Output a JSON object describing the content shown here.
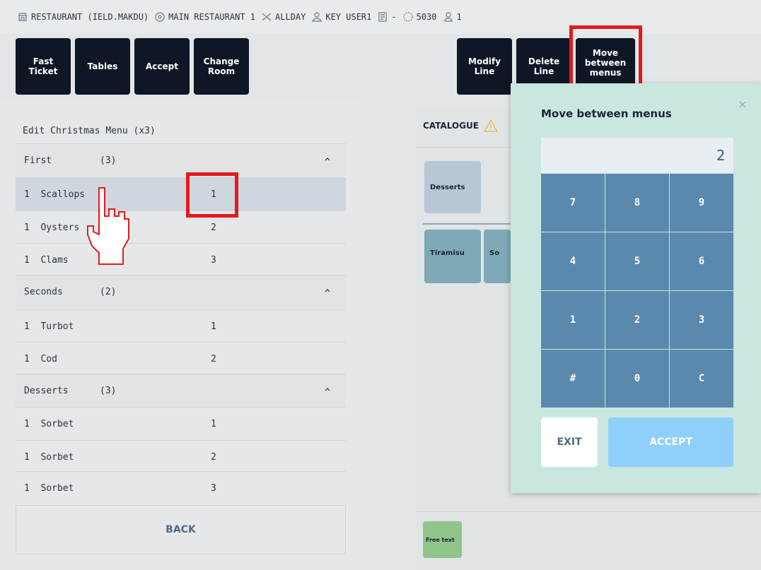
{
  "topbar": {
    "restaurant": "RESTAURANT (IELD.MAKDU)",
    "location": "MAIN RESTAURANT 1",
    "menu": "ALLDAY",
    "user": "KEY USER1",
    "doc": "-",
    "code": "5030",
    "guests": "1"
  },
  "toolbar": {
    "fast_ticket": "Fast Ticket",
    "tables": "Tables",
    "accept": "Accept",
    "change_room": "Change Room",
    "modify_line": "Modify Line",
    "delete_line": "Delete Line",
    "move_between_menus": "Move between menus"
  },
  "left": {
    "title": "Edit Christmas Menu (x3)",
    "sections": [
      {
        "name": "First",
        "count": "(3)",
        "items": [
          {
            "qty": "1",
            "name": "Scallops",
            "num": "1"
          },
          {
            "qty": "1",
            "name": "Oysters",
            "num": "2"
          },
          {
            "qty": "1",
            "name": "Clams",
            "num": "3"
          }
        ]
      },
      {
        "name": "Seconds",
        "count": "(2)",
        "items": [
          {
            "qty": "1",
            "name": "Turbot",
            "num": "1"
          },
          {
            "qty": "1",
            "name": "Cod",
            "num": "2"
          }
        ]
      },
      {
        "name": "Desserts",
        "count": "(3)",
        "items": [
          {
            "qty": "1",
            "name": "Sorbet",
            "num": "1"
          },
          {
            "qty": "1",
            "name": "Sorbet",
            "num": "2"
          },
          {
            "qty": "1",
            "name": "Sorbet",
            "num": "3"
          }
        ]
      }
    ],
    "back": "BACK"
  },
  "right": {
    "catalogue": "CATALOGUE",
    "tiles": {
      "desserts": "Desserts",
      "tiramisu": "Tiramisu",
      "sorbet_partial": "So",
      "free_text": "Free text"
    }
  },
  "modal": {
    "title": "Move between menus",
    "display_value": "2",
    "keys": [
      "7",
      "8",
      "9",
      "4",
      "5",
      "6",
      "1",
      "2",
      "3",
      "#",
      "0",
      "C"
    ],
    "exit": "EXIT",
    "accept": "ACCEPT"
  },
  "colors": {
    "dark_button": "#0e1725",
    "highlight": "#e21b1b",
    "modal_bg": "#c9e6e0",
    "key_bg": "#5b88ad",
    "accept_bg": "#8ed0fa"
  }
}
